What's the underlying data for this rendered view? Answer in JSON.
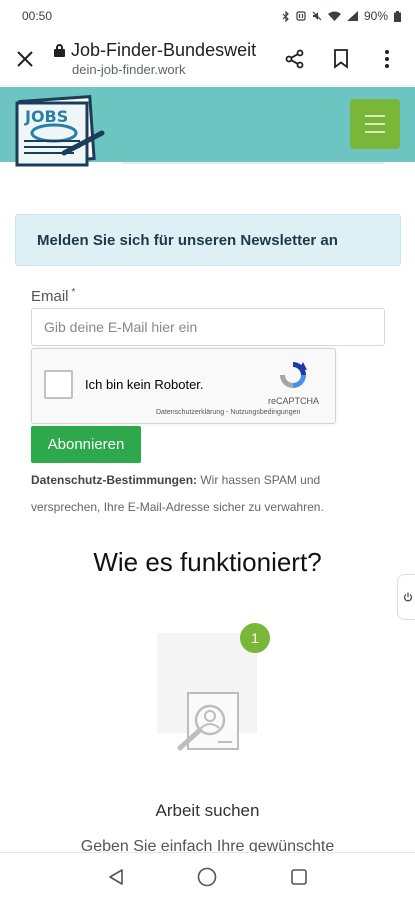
{
  "status_bar": {
    "time": "00:50",
    "battery": "90%",
    "icons": [
      "bluetooth-icon",
      "nfc-icon",
      "mute-icon",
      "wifi-icon",
      "signal-icon",
      "battery-icon"
    ]
  },
  "browser": {
    "title": "Job-Finder-Bundesweit",
    "url": "dein-job-finder.work",
    "icons": [
      "close-icon",
      "lock-icon",
      "share-icon",
      "bookmark-icon",
      "more-vert-icon"
    ]
  },
  "header": {
    "logo_text": "JOBS",
    "menu_icon": "hamburger-icon",
    "colors": {
      "header_bg": "#6cc5c0",
      "menu_bg": "#7ab637"
    }
  },
  "newsletter": {
    "title": "Melden Sie sich für unseren Newsletter an",
    "email_label": "Email",
    "required_mark": "*",
    "email_placeholder": "Gib deine E-Mail hier ein",
    "email_value": "",
    "recaptcha_label": "Ich bin kein Roboter.",
    "recaptcha_brand": "reCAPTCHA",
    "recaptcha_terms": "Datenschutzerklärung - Nutzungsbedingungen",
    "subscribe_label": "Abonnieren",
    "privacy_heading": "Datenschutz-Bestimmungen:",
    "privacy_text": " Wir hassen SPAM und versprechen, Ihre E-Mail-Adresse sicher zu verwahren.",
    "colors": {
      "box_bg": "#dcf0f6",
      "button_bg": "#2da84a"
    }
  },
  "how_it_works": {
    "title": "Wie es funktioniert?",
    "steps": [
      {
        "number": "1",
        "icon": "search-document-icon",
        "title": "Arbeit suchen",
        "description": "Geben Sie einfach Ihre gewünschte"
      }
    ]
  },
  "side_tab_icon": "power-icon",
  "nav_bar": {
    "icons": [
      "back-icon",
      "home-icon",
      "recents-icon"
    ]
  }
}
